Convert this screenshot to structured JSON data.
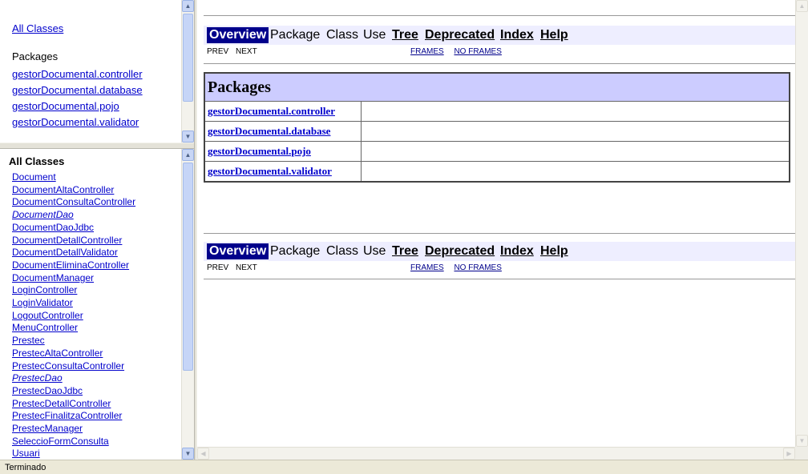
{
  "package_list_frame": {
    "all_classes_link": "All Classes",
    "packages_heading": "Packages",
    "packages": [
      "gestorDocumental.controller",
      "gestorDocumental.database",
      "gestorDocumental.pojo",
      "gestorDocumental.validator"
    ]
  },
  "class_list_frame": {
    "heading": "All Classes",
    "classes": [
      {
        "name": "Document",
        "interface": false
      },
      {
        "name": "DocumentAltaController",
        "interface": false
      },
      {
        "name": "DocumentConsultaController",
        "interface": false
      },
      {
        "name": "DocumentDao",
        "interface": true
      },
      {
        "name": "DocumentDaoJdbc",
        "interface": false
      },
      {
        "name": "DocumentDetallController",
        "interface": false
      },
      {
        "name": "DocumentDetallValidator",
        "interface": false
      },
      {
        "name": "DocumentEliminaController",
        "interface": false
      },
      {
        "name": "DocumentManager",
        "interface": false
      },
      {
        "name": "LoginController",
        "interface": false
      },
      {
        "name": "LoginValidator",
        "interface": false
      },
      {
        "name": "LogoutController",
        "interface": false
      },
      {
        "name": "MenuController",
        "interface": false
      },
      {
        "name": "Prestec",
        "interface": false
      },
      {
        "name": "PrestecAltaController",
        "interface": false
      },
      {
        "name": "PrestecConsultaController",
        "interface": false
      },
      {
        "name": "PrestecDao",
        "interface": true
      },
      {
        "name": "PrestecDaoJdbc",
        "interface": false
      },
      {
        "name": "PrestecDetallController",
        "interface": false
      },
      {
        "name": "PrestecFinalitzaController",
        "interface": false
      },
      {
        "name": "PrestecManager",
        "interface": false
      },
      {
        "name": "SeleccioFormConsulta",
        "interface": false
      },
      {
        "name": "Usuari",
        "interface": false
      }
    ]
  },
  "main_frame": {
    "navbar": {
      "overview": "Overview",
      "package": "Package",
      "class": "Class",
      "use": "Use",
      "tree": "Tree",
      "deprecated": "Deprecated",
      "index": "Index",
      "help": "Help"
    },
    "subnav": {
      "prev": "PREV",
      "next": "NEXT",
      "frames": "FRAMES",
      "no_frames": "NO FRAMES"
    },
    "packages_table": {
      "heading": "Packages",
      "rows": [
        {
          "name": "gestorDocumental.controller",
          "description": ""
        },
        {
          "name": "gestorDocumental.database",
          "description": ""
        },
        {
          "name": "gestorDocumental.pojo",
          "description": ""
        },
        {
          "name": "gestorDocumental.validator",
          "description": ""
        }
      ]
    }
  },
  "status_bar": {
    "text": "Terminado"
  },
  "colors": {
    "navbar_bg": "#eeeeff",
    "navbar_active_bg": "#00008b",
    "table_header_bg": "#ccccff",
    "link": "#0000cc"
  },
  "icons": {
    "scroll_up": "scroll-up-arrow-icon",
    "scroll_down": "scroll-down-arrow-icon",
    "scroll_left": "scroll-left-arrow-icon",
    "scroll_right": "scroll-right-arrow-icon"
  }
}
